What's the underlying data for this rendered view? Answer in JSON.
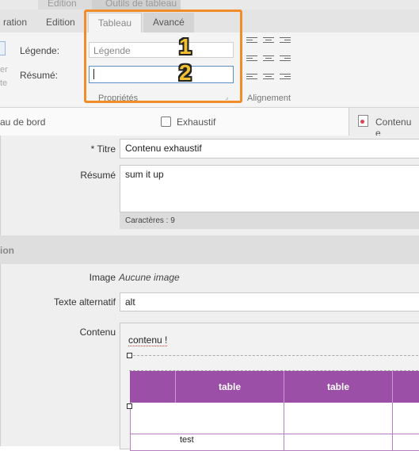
{
  "ribbon": {
    "context_tabs": [
      "Edition",
      "Outils de tableau"
    ],
    "tabs": [
      "ration",
      "Edition",
      "Tableau",
      "Avancé"
    ],
    "legend_label": "Légende:",
    "legend_placeholder": "Légende",
    "summary_label": "Résumé:",
    "summary_value": "",
    "left_fragments": [
      "er",
      "te"
    ],
    "group_properties": "Propriétés",
    "group_alignment": "Alignement"
  },
  "annotations": [
    "1",
    "2"
  ],
  "page_tabs": [
    "au de bord",
    "Exhaustif",
    "Contenu e"
  ],
  "form": {
    "title_label": "* Titre",
    "title_value": "Contenu exhaustif",
    "summary_label": "Résumé",
    "summary_value": "sum it up",
    "char_count": "Caractères : 9",
    "section_label": "ion",
    "image_label": "Image",
    "image_value": "Aucune image",
    "alt_label": "Texte alternatif",
    "alt_value": "alt",
    "content_label": "Contenu"
  },
  "editor": {
    "paragraph": "contenu !",
    "headers": [
      "",
      "table",
      "table",
      ""
    ],
    "cell_text": "test"
  },
  "colors": {
    "highlight": "#f28c28",
    "table_header": "#9b4fa6",
    "focus_border": "#5b8fc9"
  }
}
